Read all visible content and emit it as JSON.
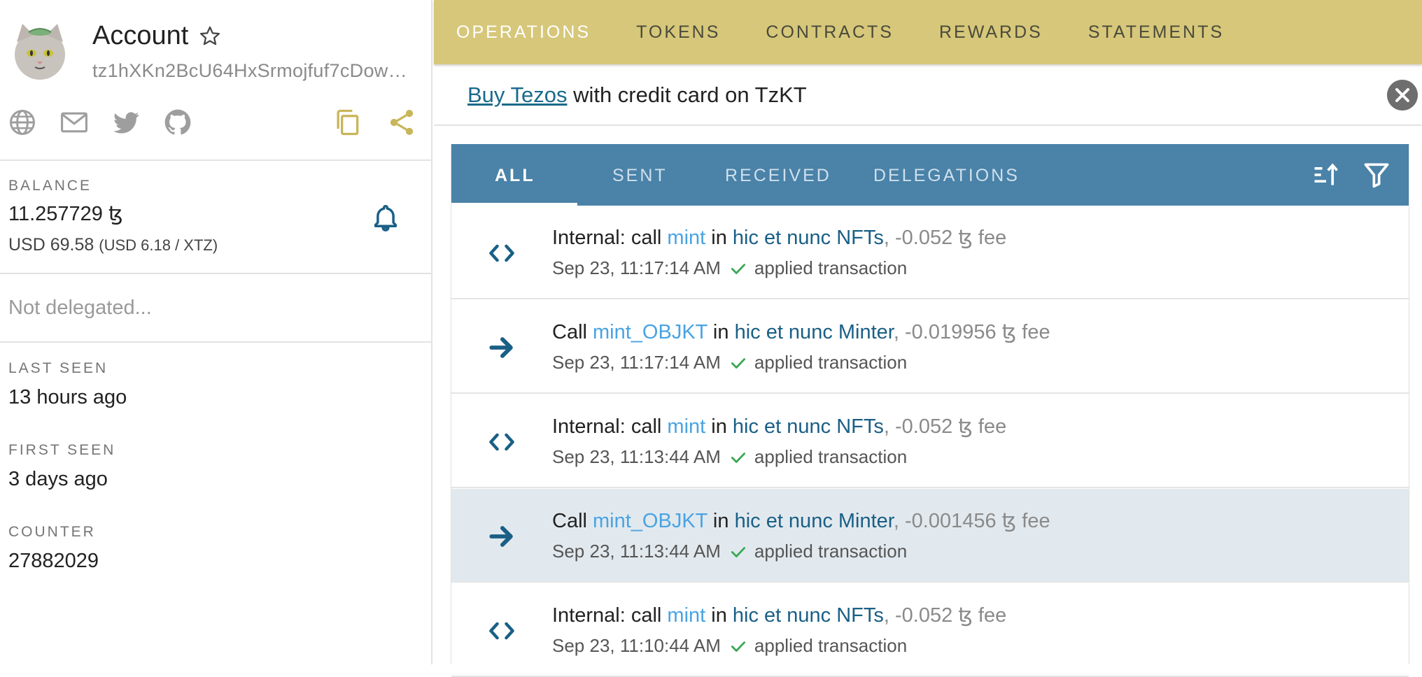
{
  "account": {
    "title": "Account",
    "address": "tz1hXKn2BcU64HxSrmojfuf7cDow…"
  },
  "icons": {
    "left_row": [
      "globe-icon",
      "mail-icon",
      "twitter-icon",
      "github-icon"
    ],
    "right_row": [
      "copy-icon",
      "share-icon"
    ]
  },
  "balance": {
    "label": "BALANCE",
    "value": "11.257729 ꜩ",
    "usd": "USD 69.58",
    "rate": "(USD 6.18 / XTZ)"
  },
  "delegation": {
    "text": "Not delegated..."
  },
  "last_seen": {
    "label": "LAST SEEN",
    "value": "13 hours ago"
  },
  "first_seen": {
    "label": "FIRST SEEN",
    "value": "3 days ago"
  },
  "counter": {
    "label": "COUNTER",
    "value": "27882029"
  },
  "top_tabs": [
    "OPERATIONS",
    "TOKENS",
    "CONTRACTS",
    "REWARDS",
    "STATEMENTS"
  ],
  "banner": {
    "link": "Buy Tezos",
    "rest": " with credit card on TzKT"
  },
  "filter_tabs": [
    "ALL",
    "SENT",
    "RECEIVED",
    "DELEGATIONS"
  ],
  "operations": [
    {
      "icon": "code-icon",
      "prefix": "Internal: call ",
      "method": "mint",
      "mid": " in ",
      "target": "hic et nunc NFTs",
      "fee": ", -0.052 ꜩ fee",
      "time": "Sep 23, 11:17:14 AM",
      "status": "applied transaction"
    },
    {
      "icon": "arrow-right-icon",
      "prefix": "Call ",
      "method": "mint_OBJKT",
      "mid": " in ",
      "target": "hic et nunc Minter",
      "fee": ", -0.019956 ꜩ fee",
      "time": "Sep 23, 11:17:14 AM",
      "status": "applied transaction"
    },
    {
      "icon": "code-icon",
      "prefix": "Internal: call ",
      "method": "mint",
      "mid": " in ",
      "target": "hic et nunc NFTs",
      "fee": ", -0.052 ꜩ fee",
      "time": "Sep 23, 11:13:44 AM",
      "status": "applied transaction"
    },
    {
      "icon": "arrow-right-icon",
      "prefix": "Call ",
      "method": "mint_OBJKT",
      "mid": " in ",
      "target": "hic et nunc Minter",
      "fee": ", -0.001456 ꜩ fee",
      "time": "Sep 23, 11:13:44 AM",
      "status": "applied transaction"
    },
    {
      "icon": "code-icon",
      "prefix": "Internal: call ",
      "method": "mint",
      "mid": " in ",
      "target": "hic et nunc NFTs",
      "fee": ", -0.052 ꜩ fee",
      "time": "Sep 23, 11:10:44 AM",
      "status": "applied transaction"
    }
  ],
  "colors": {
    "top_nav": "#d6c77a",
    "ops_bar": "#4a82a8",
    "method": "#4aa3e3",
    "target": "#1a5f86",
    "check": "#3aa855",
    "icon_accent": "#c9b65a",
    "row_highlight": "#e2e9ee"
  }
}
